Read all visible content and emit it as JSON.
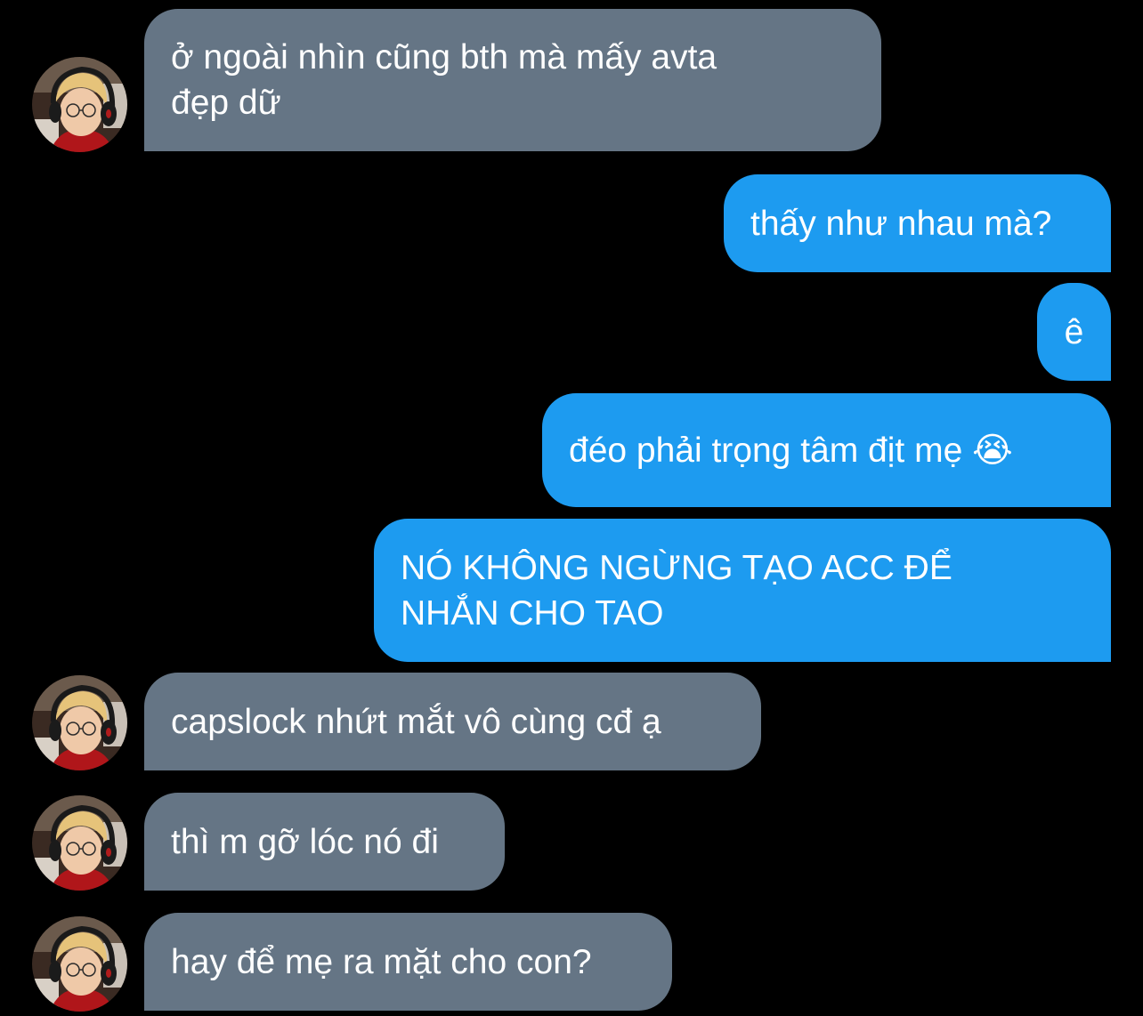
{
  "messages": [
    {
      "direction": "in",
      "text": "ở ngoài nhìn cũng bth mà mấy avta\nđẹp dữ"
    },
    {
      "direction": "out",
      "text": "thấy như nhau mà?"
    },
    {
      "direction": "out",
      "text": "ê"
    },
    {
      "direction": "out",
      "text": "đéo phải trọng tâm địt mẹ 😭"
    },
    {
      "direction": "out",
      "text": "NÓ KHÔNG NGỪNG TẠO ACC ĐỂ\nNHẮN CHO TAO"
    },
    {
      "direction": "in",
      "text": "capslock nhứt mắt vô cùng cđ ạ"
    },
    {
      "direction": "in",
      "text": "thì m gỡ lóc nó đi"
    },
    {
      "direction": "in",
      "text": "hay để mẹ ra mặt cho con?"
    }
  ],
  "colors": {
    "background": "#000000",
    "incoming_bubble": "#657585",
    "outgoing_bubble": "#1d9bf0",
    "text": "#ffffff"
  },
  "icons": {
    "avatar": "user-avatar-photo"
  }
}
